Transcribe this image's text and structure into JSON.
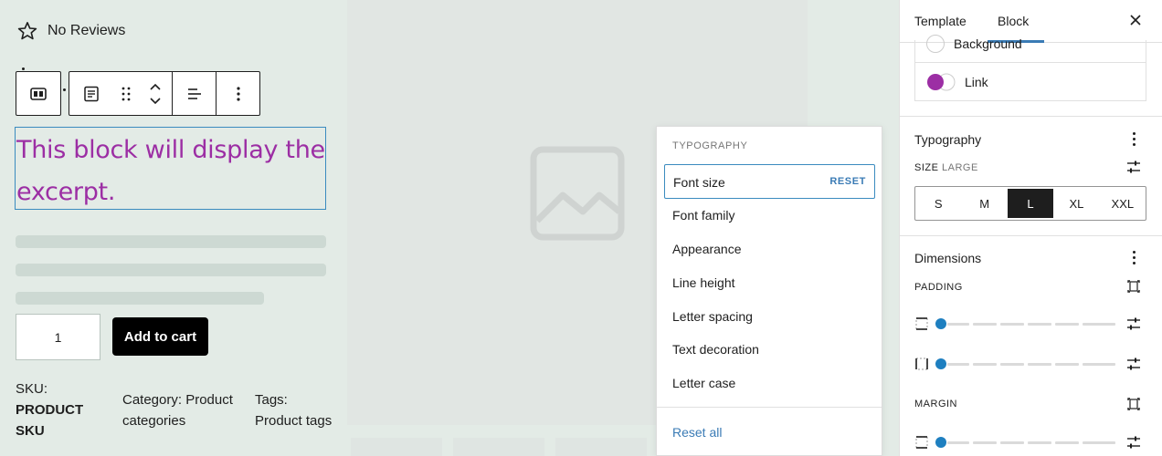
{
  "reviews": {
    "label": "No Reviews",
    "icon": "star-outline-icon"
  },
  "block_toolbar": {
    "icons": [
      "columns-icon",
      "excerpt-block-icon",
      "drag-handle-icon",
      "move-up-down-icon",
      "align-icon",
      "more-options-icon"
    ]
  },
  "excerpt": {
    "text": "This block will display the excerpt."
  },
  "product": {
    "quantity": "1",
    "add_to_cart": "Add to cart",
    "sku_label": "SKU:",
    "sku_value_line1": "PRODUCT",
    "sku_value_line2": "SKU",
    "category_label": "Category:",
    "category_value_a": "Product",
    "category_value_b": "categories",
    "tags_label": "Tags:",
    "tags_value": "Product tags"
  },
  "typography_menu": {
    "title": "TYPOGRAPHY",
    "active_item": "Font size",
    "reset_label": "RESET",
    "items": [
      "Font family",
      "Appearance",
      "Line height",
      "Letter spacing",
      "Text decoration",
      "Letter case"
    ],
    "reset_all": "Reset all"
  },
  "sidebar": {
    "tabs": {
      "template": "Template",
      "block": "Block"
    },
    "colors": {
      "background": "Background",
      "link": "Link"
    },
    "typography": {
      "title": "Typography",
      "size_label": "SIZE",
      "size_value": "LARGE",
      "options": [
        "S",
        "M",
        "L",
        "XL",
        "XXL"
      ],
      "selected": "L"
    },
    "dimensions": {
      "title": "Dimensions",
      "padding_label": "PADDING",
      "margin_label": "MARGIN",
      "padding_sliders": [
        0,
        0
      ],
      "margin_sliders": [
        0
      ]
    }
  },
  "colors": {
    "accent": "#3a7bb5",
    "excerpt_text": "#9c2ea4",
    "link_swatch": "#9c2ea4"
  }
}
